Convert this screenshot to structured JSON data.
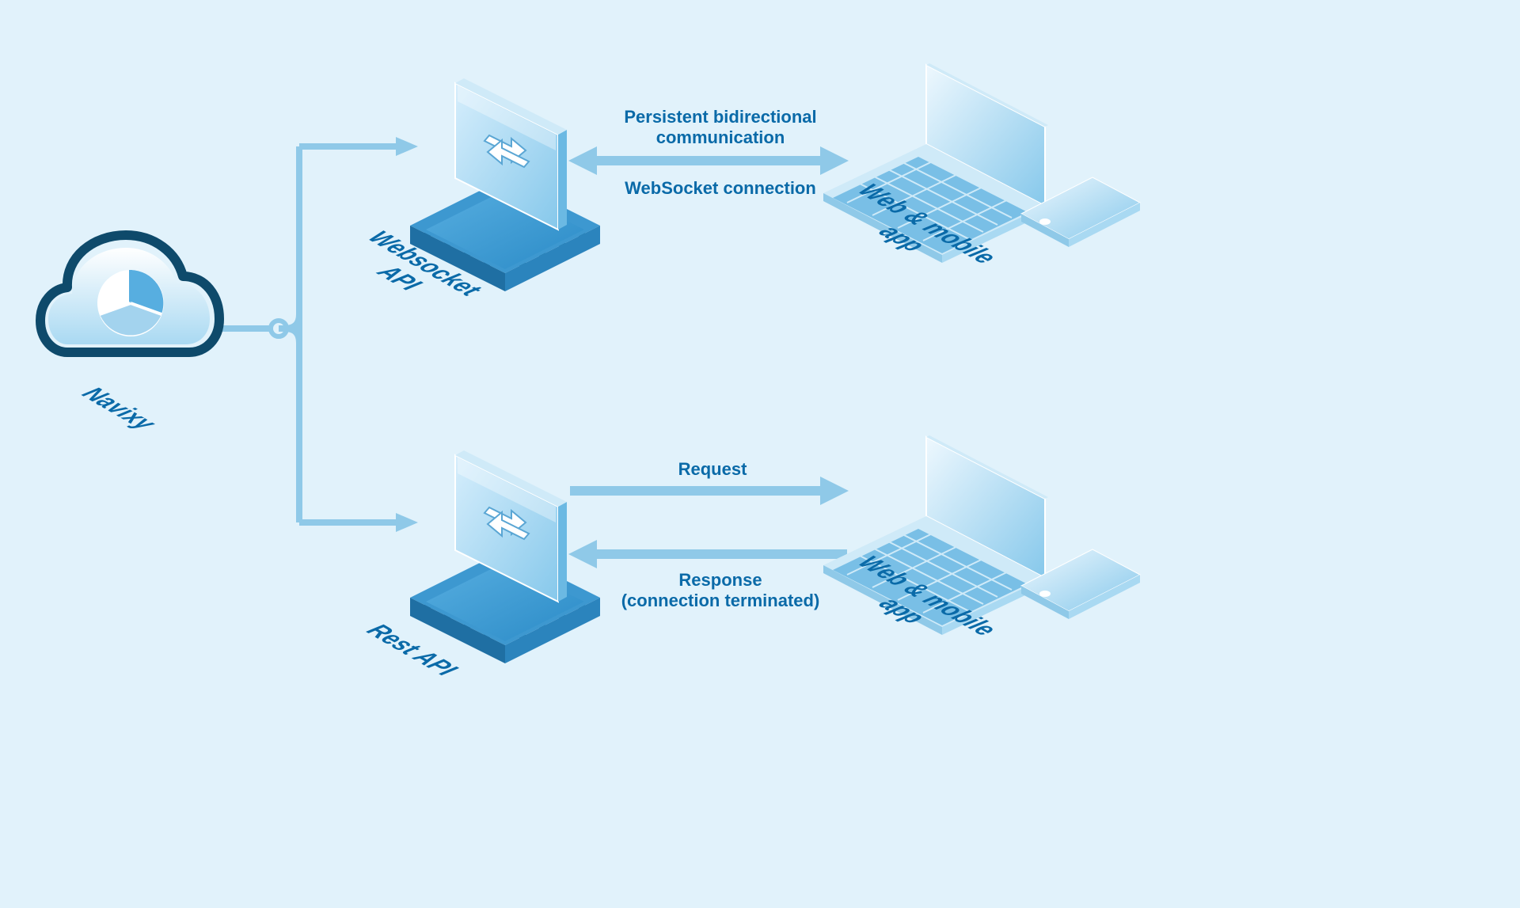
{
  "nodes": {
    "navixy": {
      "label": "Navixy"
    },
    "websocket_api": {
      "label": "Websocket\nAPI"
    },
    "rest_api": {
      "label": "Rest API"
    },
    "client_top": {
      "label": "Web & mobile\napp"
    },
    "client_bottom": {
      "label": "Web & mobile\napp"
    }
  },
  "edges": {
    "ws_top": {
      "line1": "Persistent bidirectional",
      "line2": "communication"
    },
    "ws_bottom": {
      "label": "WebSocket connection"
    },
    "rest_request": {
      "label": "Request"
    },
    "rest_response": {
      "line1": "Response",
      "line2": "(connection terminated)"
    }
  },
  "colors": {
    "bg": "#e1f2fb",
    "line": "#8fc9e8",
    "text": "#0a6aa8",
    "mid": "#57aee0",
    "midlight": "#a9d9f2",
    "dark": "#0e4a6b",
    "white": "#ffffff"
  }
}
